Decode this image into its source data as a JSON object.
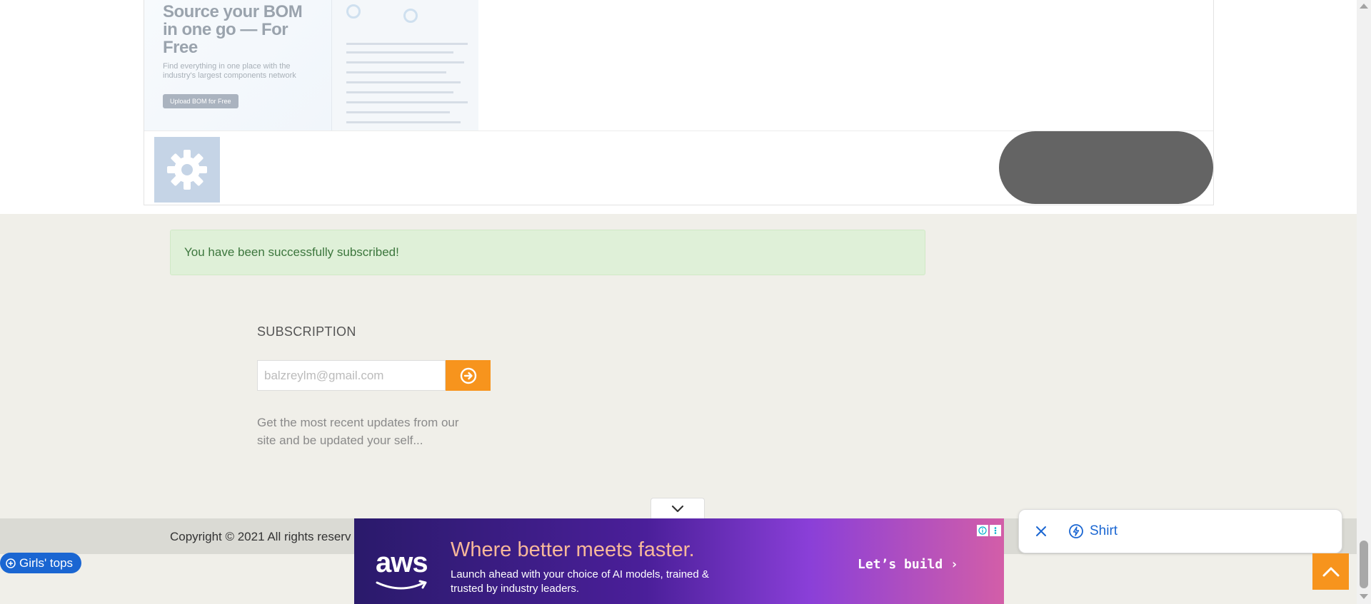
{
  "bom_ad": {
    "title": "Source your BOM in one go — For Free",
    "subtitle": "Find everything in one place with the industry's largest components network",
    "button": "Upload BOM for Free"
  },
  "alert": {
    "message": "You have been successfully subscribed!"
  },
  "subscription": {
    "heading": "SUBSCRIPTION",
    "email_value": "",
    "email_placeholder": "balzreylm@gmail.com",
    "description": "Get the most recent updates from our site and be updated your self..."
  },
  "footer": {
    "copyright": "Copyright © 2021 All rights reserv"
  },
  "girls_pill": {
    "label": "Girls' tops"
  },
  "aws_ad": {
    "logo": "aws",
    "headline": "Where better meets faster.",
    "body": "Launch ahead with your choice of AI models, trained & trusted by industry leaders.",
    "cta": "Let’s build ›"
  },
  "shirt_card": {
    "label": "Shirt"
  },
  "colors": {
    "accent_orange": "#f7941d",
    "link_blue": "#1a66d2",
    "success_bg": "#dff0d8",
    "success_text": "#3c763d",
    "footer_bg": "#dadad4",
    "page_bg": "#f0efe9"
  },
  "icons": {
    "gear": "gear-icon",
    "submit": "arrow-circle-right-icon",
    "collapse": "chevron-down-icon",
    "close": "close-icon",
    "bolt": "bolt-circle-icon",
    "scroll_top": "chevron-up-icon",
    "plus_circle": "plus-circle-icon"
  }
}
